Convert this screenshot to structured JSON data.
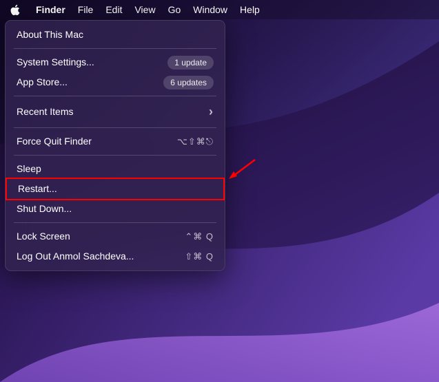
{
  "menubar": {
    "app": "Finder",
    "items": [
      "File",
      "Edit",
      "View",
      "Go",
      "Window",
      "Help"
    ]
  },
  "menu": {
    "about": "About This Mac",
    "settings": {
      "label": "System Settings...",
      "badge": "1 update"
    },
    "appstore": {
      "label": "App Store...",
      "badge": "6 updates"
    },
    "recent": {
      "label": "Recent Items",
      "chevron": "›"
    },
    "forcequit": {
      "label": "Force Quit Finder",
      "shortcut": "⌥⇧⌘⎋"
    },
    "sleep": "Sleep",
    "restart": "Restart...",
    "shutdown": "Shut Down...",
    "lock": {
      "label": "Lock Screen",
      "shortcut": "⌃⌘ Q"
    },
    "logout": {
      "label": "Log Out Anmol Sachdeva...",
      "shortcut": "⇧⌘ Q"
    }
  }
}
